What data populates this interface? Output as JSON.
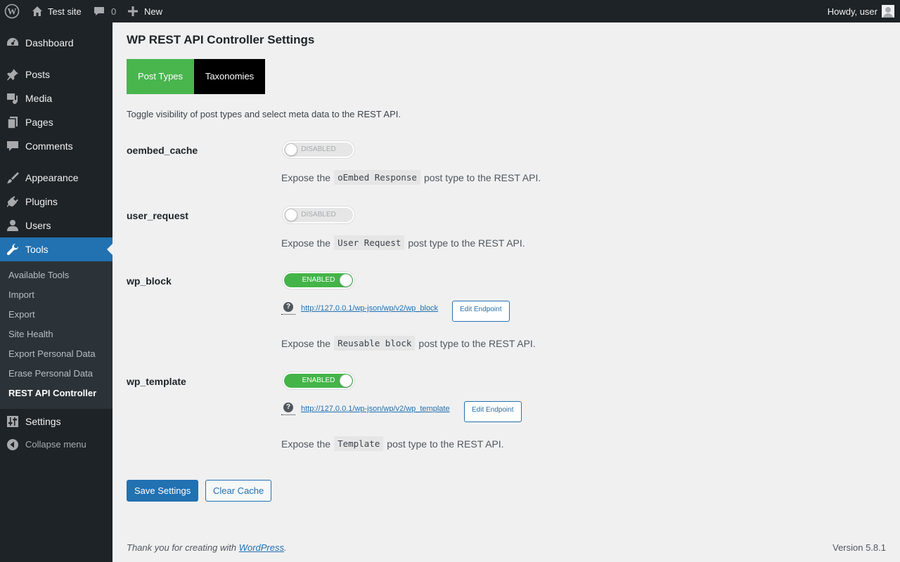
{
  "adminbar": {
    "site_name": "Test site",
    "comments_count": "0",
    "new_label": "New",
    "greeting": "Howdy, user"
  },
  "sidebar": {
    "items": [
      {
        "label": "Dashboard",
        "icon": "dashboard-icon"
      },
      {
        "label": "Posts",
        "icon": "pin-icon"
      },
      {
        "label": "Media",
        "icon": "media-icon"
      },
      {
        "label": "Pages",
        "icon": "pages-icon"
      },
      {
        "label": "Comments",
        "icon": "comment-icon"
      },
      {
        "label": "Appearance",
        "icon": "brush-icon"
      },
      {
        "label": "Plugins",
        "icon": "plug-icon"
      },
      {
        "label": "Users",
        "icon": "user-icon"
      },
      {
        "label": "Tools",
        "icon": "wrench-icon"
      },
      {
        "label": "Settings",
        "icon": "sliders-icon"
      }
    ],
    "submenu": [
      "Available Tools",
      "Import",
      "Export",
      "Site Health",
      "Export Personal Data",
      "Erase Personal Data",
      "REST API Controller"
    ],
    "collapse_label": "Collapse menu"
  },
  "page": {
    "title": "WP REST API Controller Settings",
    "tabs": [
      "Post Types",
      "Taxonomies"
    ],
    "intro": "Toggle visibility of post types and select meta data to the REST API."
  },
  "rows": [
    {
      "name": "oembed_cache",
      "toggle": "DISABLED",
      "desc_prefix": "Expose the",
      "code": "oEmbed Response",
      "desc_suffix": "post type to the REST API."
    },
    {
      "name": "user_request",
      "toggle": "DISABLED",
      "desc_prefix": "Expose the",
      "code": "User Request",
      "desc_suffix": "post type to the REST API."
    },
    {
      "name": "wp_block",
      "toggle": "ENABLED",
      "endpoint": "http://127.0.0.1/wp-json/wp/v2/wp_block",
      "edit_label": "Edit Endpoint",
      "desc_prefix": "Expose the",
      "code": "Reusable block",
      "desc_suffix": "post type to the REST API."
    },
    {
      "name": "wp_template",
      "toggle": "ENABLED",
      "endpoint": "http://127.0.0.1/wp-json/wp/v2/wp_template",
      "edit_label": "Edit Endpoint",
      "desc_prefix": "Expose the",
      "code": "Template",
      "desc_suffix": "post type to the REST API."
    }
  ],
  "actions": {
    "save_label": "Save Settings",
    "clear_label": "Clear Cache"
  },
  "footer": {
    "thanks_prefix": "Thank you for creating with ",
    "thanks_link": "WordPress",
    "thanks_suffix": ".",
    "version": "Version 5.8.1"
  }
}
